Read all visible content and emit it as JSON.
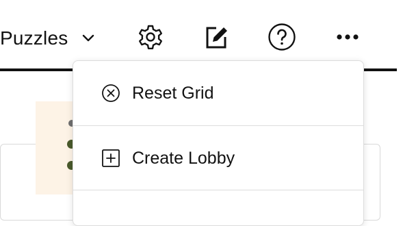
{
  "toolbar": {
    "puzzles_label": "Puzzles",
    "icons": [
      "chevron-down-icon",
      "gear-icon",
      "edit-icon",
      "help-icon",
      "more-icon"
    ]
  },
  "dropdown": {
    "items": [
      {
        "label": "Reset Grid",
        "icon": "close-circle-icon"
      },
      {
        "label": "Create Lobby",
        "icon": "plus-square-icon"
      }
    ]
  },
  "colors": {
    "text": "#121212",
    "accent_tile": "#fdf3e6",
    "dot": "#4a5a2c",
    "divider": "#dcdcdc"
  }
}
